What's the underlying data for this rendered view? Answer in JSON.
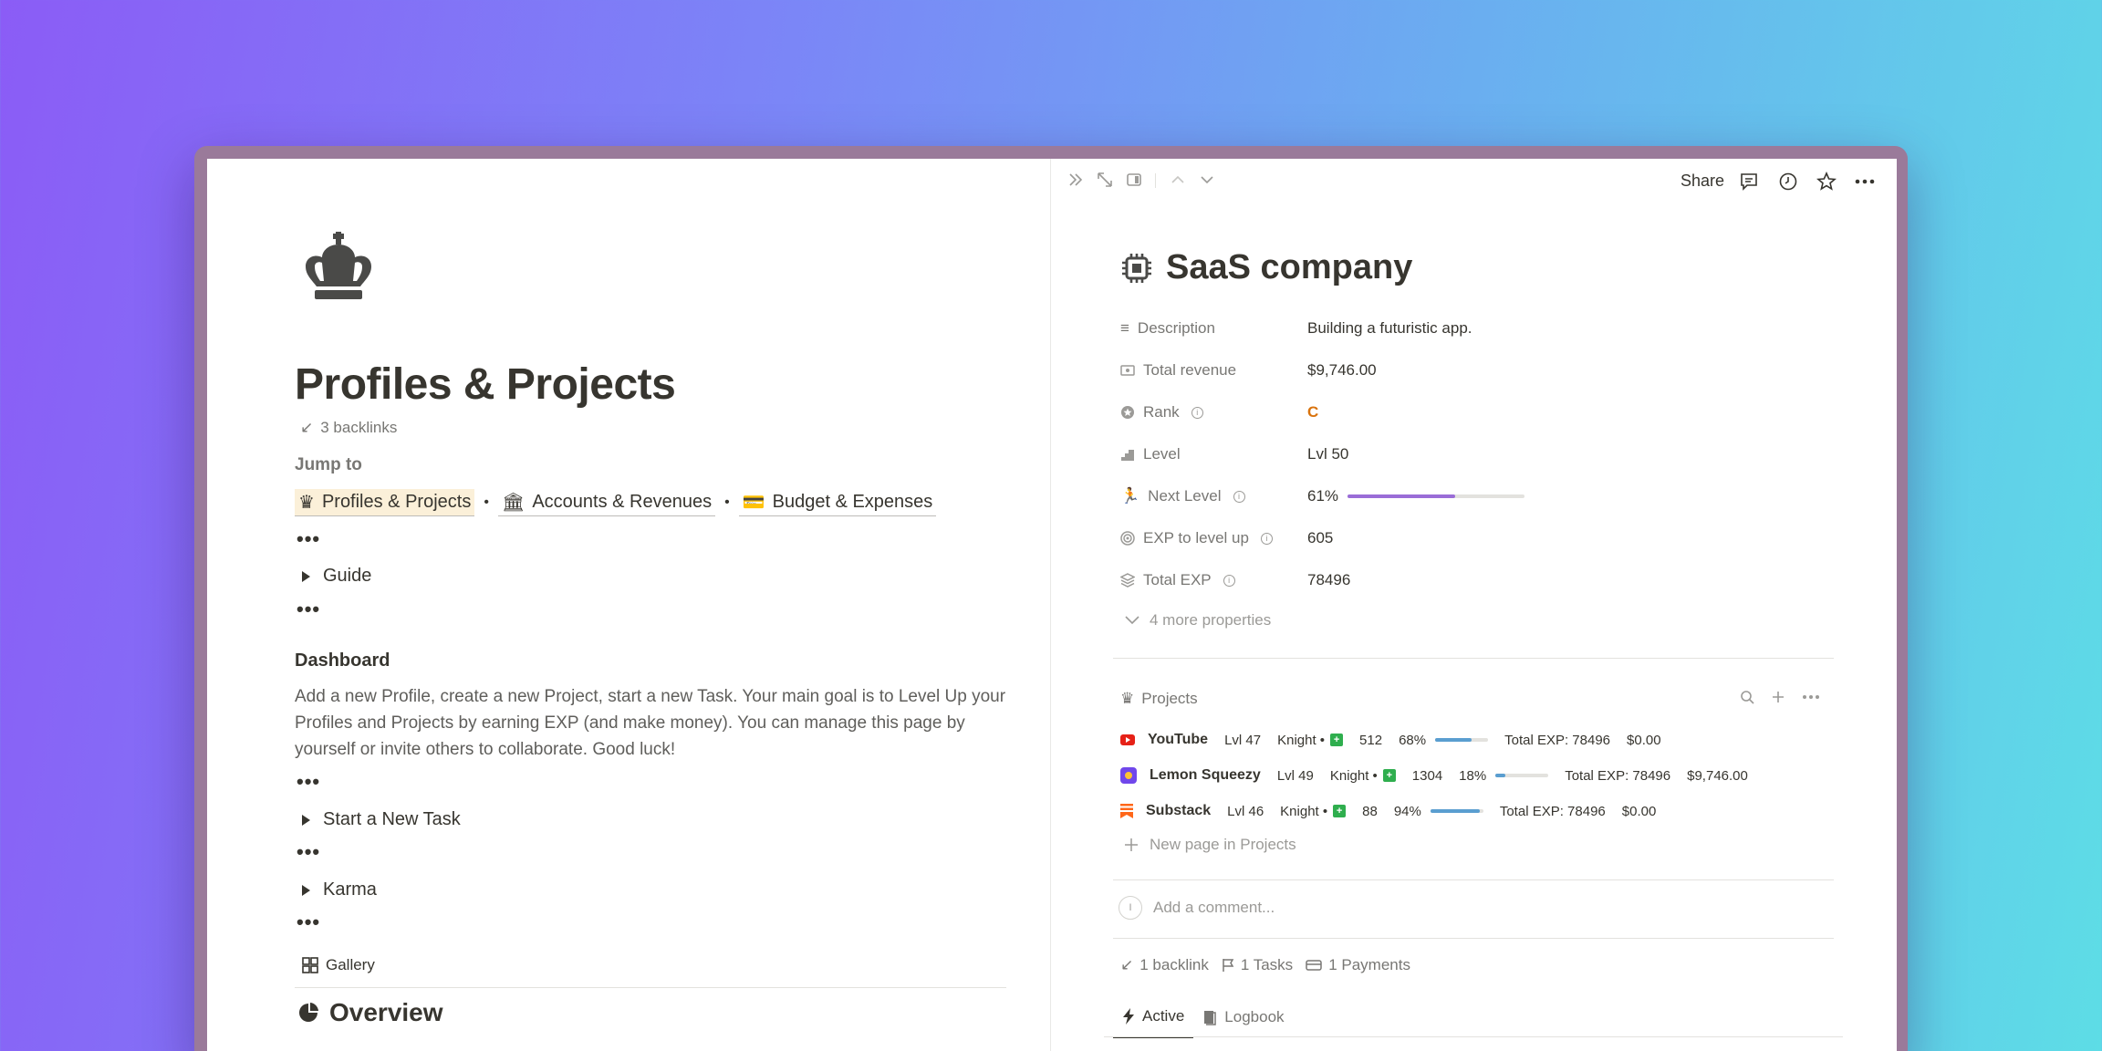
{
  "left": {
    "title": "Profiles & Projects",
    "backlinks": "3 backlinks",
    "jump_to": "Jump to",
    "jump_links": [
      "Profiles & Projects",
      "Accounts & Revenues",
      "Budget & Expenses"
    ],
    "toggles": [
      "Guide",
      "Start a New Task",
      "Karma"
    ],
    "dots": "•••",
    "dashboard_heading": "Dashboard",
    "dashboard_text": "Add a new Profile, create a new Project, start a new Task. Your main goal is to Level Up your Profiles and Projects by earning EXP (and make money). You can manage this page by yourself or invite others to collaborate. Good luck!",
    "gallery_label": "Gallery",
    "overview_heading": "Overview"
  },
  "right": {
    "share": "Share",
    "title": "SaaS company",
    "properties": [
      {
        "label": "Description",
        "value": "Building a futuristic app.",
        "icon": "text-lines-icon"
      },
      {
        "label": "Total revenue",
        "value": "$9,746.00",
        "icon": "banknote-icon"
      },
      {
        "label": "Rank",
        "value": "C",
        "icon": "star-circle-icon"
      },
      {
        "label": "Level",
        "value": "Lvl 50",
        "icon": "stairs-icon"
      },
      {
        "label": "Next Level",
        "value": "61%",
        "icon": "runner-icon",
        "progress": 0.61
      },
      {
        "label": "EXP to level up",
        "value": "605",
        "icon": "target-icon"
      },
      {
        "label": "Total EXP",
        "value": "78496",
        "icon": "layers-icon"
      }
    ],
    "more_properties": "4 more properties",
    "projects_label": "Projects",
    "projects": [
      {
        "name": "YouTube",
        "lvl": "Lvl 47",
        "rank": "Knight •",
        "exp": "512",
        "pct": "68%",
        "progress": 0.68,
        "total": "Total EXP: 78496",
        "money": "$0.00",
        "color": "#e62117"
      },
      {
        "name": "Lemon Squeezy",
        "lvl": "Lvl 49",
        "rank": "Knight •",
        "exp": "1304",
        "pct": "18%",
        "progress": 0.18,
        "total": "Total EXP: 78496",
        "money": "$9,746.00",
        "color": "#7047eb"
      },
      {
        "name": "Substack",
        "lvl": "Lvl 46",
        "rank": "Knight •",
        "exp": "88",
        "pct": "94%",
        "progress": 0.94,
        "total": "Total EXP: 78496",
        "money": "$0.00",
        "color": "#ff6719"
      }
    ],
    "new_page": "New page in Projects",
    "add_comment": "Add a comment...",
    "avatar_letter": "I",
    "footer_links": [
      "1 backlink",
      "1 Tasks",
      "1 Payments"
    ],
    "tabs": [
      "Active",
      "Logbook"
    ],
    "colors": {
      "rank": "#d9730d",
      "next_level_bar": "#9a6dd7",
      "project_bar": "#5a9ed0"
    }
  }
}
